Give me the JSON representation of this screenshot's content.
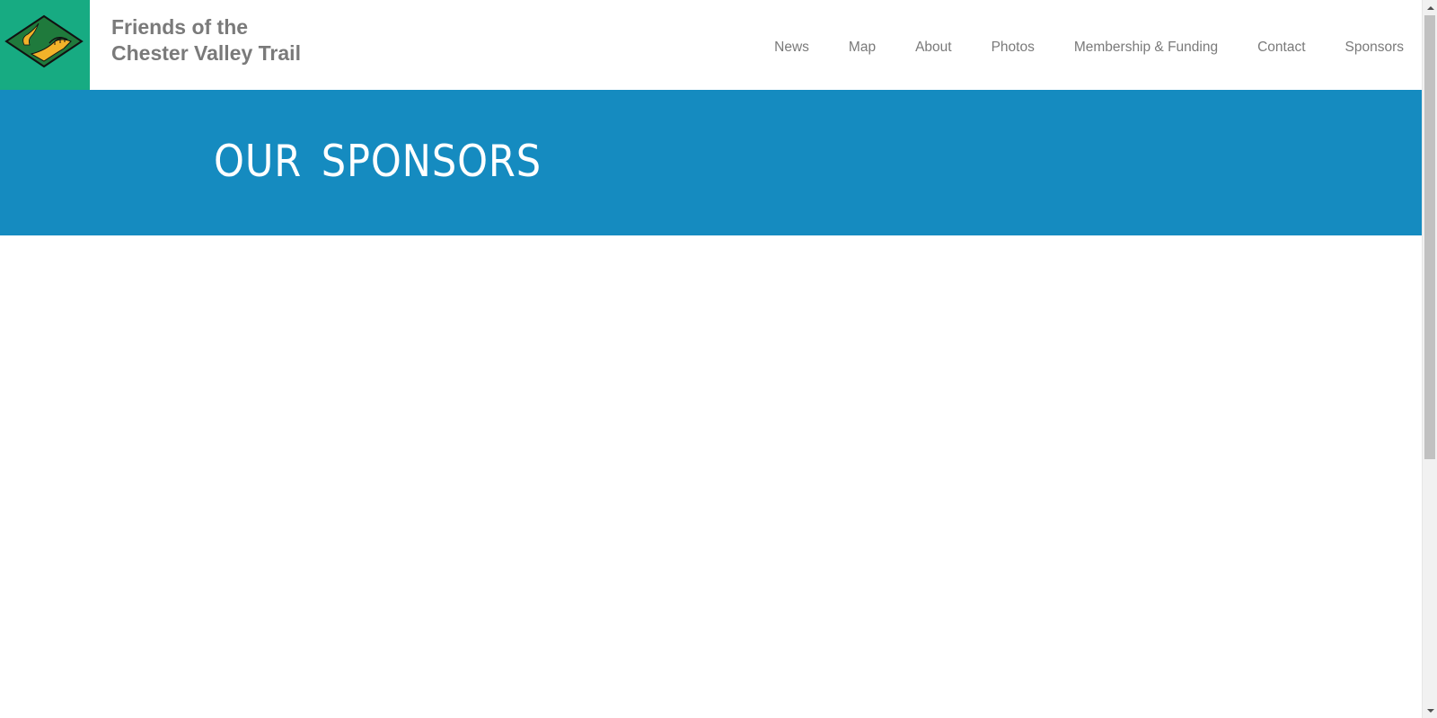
{
  "header": {
    "site_title_line1": "Friends of the",
    "site_title_line2": "Chester Valley Trail",
    "logo_icon": "trail-diamond-logo-icon",
    "logo_bg_color": "#17ab82"
  },
  "nav": {
    "items": [
      {
        "label": "News"
      },
      {
        "label": "Map"
      },
      {
        "label": "About"
      },
      {
        "label": "Photos"
      },
      {
        "label": "Membership & Funding"
      },
      {
        "label": "Contact"
      },
      {
        "label": "Sponsors"
      }
    ],
    "text_color": "#7a7a7a"
  },
  "banner": {
    "title": "OUR SPONSORS",
    "bg_color": "#158bc0",
    "text_color": "#ffffff"
  }
}
